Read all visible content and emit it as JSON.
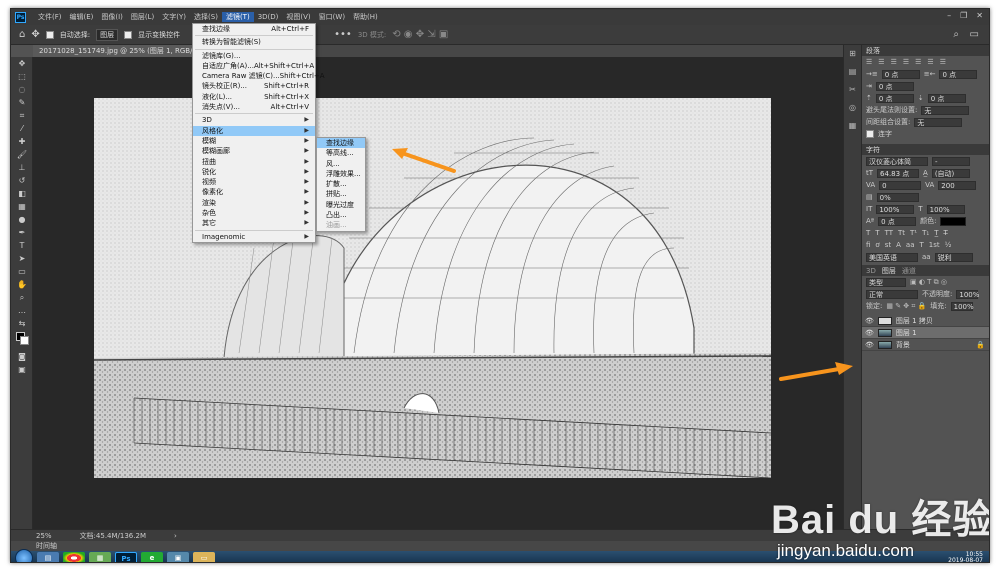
{
  "menubar": {
    "items": [
      "文件(F)",
      "编辑(E)",
      "图像(I)",
      "图层(L)",
      "文字(Y)",
      "选择(S)",
      "滤镜(T)",
      "3D(D)",
      "视图(V)",
      "窗口(W)",
      "帮助(H)"
    ]
  },
  "options": {
    "auto_select_label": "自动选择:",
    "auto_select_value": "图层",
    "show_transform_label": "显示变换控件",
    "mode_3d_label": "3D 模式:"
  },
  "document": {
    "tab_title": "20171028_151749.jpg @ 25% (图层 1, RGB/8) *"
  },
  "filter_menu": {
    "items": [
      {
        "label": "查找边缘",
        "shortcut": "Alt+Ctrl+F"
      },
      {
        "label": "转换为智能滤镜(S)",
        "shortcut": ""
      },
      {
        "label": "滤镜库(G)...",
        "shortcut": ""
      },
      {
        "label": "自适应广角(A)...",
        "shortcut": "Alt+Shift+Ctrl+A"
      },
      {
        "label": "Camera Raw 滤镜(C)...",
        "shortcut": "Shift+Ctrl+A"
      },
      {
        "label": "镜头校正(R)...",
        "shortcut": "Shift+Ctrl+R"
      },
      {
        "label": "液化(L)...",
        "shortcut": "Shift+Ctrl+X"
      },
      {
        "label": "消失点(V)...",
        "shortcut": "Alt+Ctrl+V"
      },
      {
        "label": "3D",
        "shortcut": ""
      },
      {
        "label": "风格化",
        "shortcut": ""
      },
      {
        "label": "模糊",
        "shortcut": ""
      },
      {
        "label": "模糊画廊",
        "shortcut": ""
      },
      {
        "label": "扭曲",
        "shortcut": ""
      },
      {
        "label": "锐化",
        "shortcut": ""
      },
      {
        "label": "视频",
        "shortcut": ""
      },
      {
        "label": "像素化",
        "shortcut": ""
      },
      {
        "label": "渲染",
        "shortcut": ""
      },
      {
        "label": "杂色",
        "shortcut": ""
      },
      {
        "label": "其它",
        "shortcut": ""
      },
      {
        "label": "Imagenomic",
        "shortcut": ""
      }
    ]
  },
  "stylize_submenu": {
    "items": [
      "查找边缘",
      "等高线...",
      "风...",
      "浮雕效果...",
      "扩散...",
      "拼贴...",
      "曝光过度",
      "凸出...",
      "油画..."
    ]
  },
  "paragraph_panel": {
    "title": "段落",
    "indent_left": "0 点",
    "indent_right": "0 点",
    "indent_first": "0 点",
    "space_before": "0 点",
    "space_after": "0 点",
    "avoid_label": "避头尾法则设置:",
    "avoid_value": "无",
    "spacing_label": "间距组合设置:",
    "spacing_value": "无",
    "hyphenate_label": "连字"
  },
  "character_panel": {
    "title": "字符",
    "font_family": "汉仪菱心体简",
    "font_style": "-",
    "font_size": "64.83 点",
    "leading": "(自动)",
    "kerning": "0",
    "tracking": "200",
    "vscale": "0%",
    "scale_v": "100%",
    "scale_h": "100%",
    "baseline": "0 点",
    "color_label": "颜色:",
    "language": "美国英语",
    "aa": "锐利"
  },
  "layers_panel": {
    "tabs": [
      "3D",
      "图层",
      "通道"
    ],
    "kind": "类型",
    "blend": "正常",
    "opacity_label": "不透明度:",
    "opacity": "100%",
    "lock_label": "锁定:",
    "fill_label": "填充:",
    "fill": "100%",
    "layers": [
      {
        "name": "图层 1 拷贝"
      },
      {
        "name": "图层 1"
      },
      {
        "name": "背景"
      }
    ]
  },
  "status": {
    "zoom": "25%",
    "doc_size": "文档:45.4M/136.2M",
    "timeline": "时间轴"
  },
  "taskbar": {
    "time": "10:55",
    "date": "2019-08-07"
  },
  "watermark": {
    "brand": "Bai du 经验",
    "url": "jingyan.baidu.com"
  },
  "colors": {
    "highlight": "#91c9f7",
    "arrow": "#f7941d",
    "menu_active": "#2a5fa8"
  }
}
